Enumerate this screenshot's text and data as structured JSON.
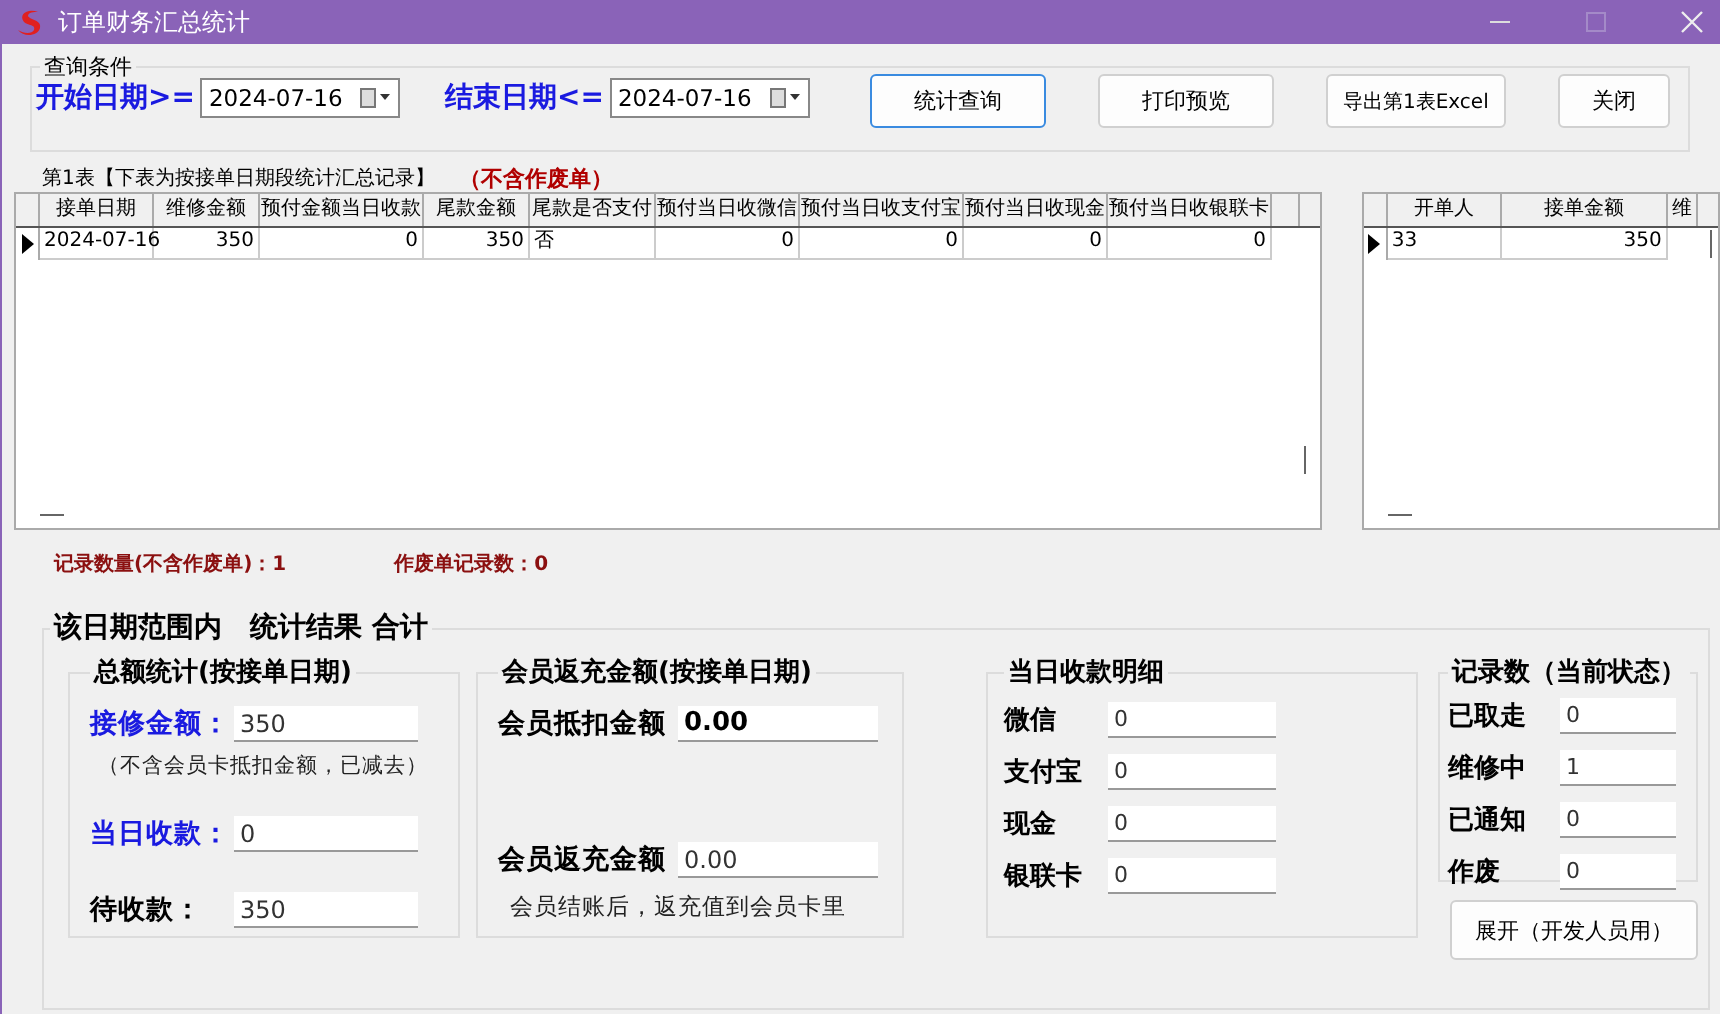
{
  "window": {
    "title": "订单财务汇总统计"
  },
  "query": {
    "legend": "查询条件",
    "start_label": "开始日期>=",
    "start_date": "2024-07-16",
    "end_label": "结束日期<=",
    "end_date": "2024-07-16",
    "buttons": [
      {
        "label": "统计查询",
        "focused": true
      },
      {
        "label": "打印预览",
        "focused": false
      },
      {
        "label": "导出第1表Excel",
        "focused": false
      },
      {
        "label": "关闭",
        "focused": false
      }
    ]
  },
  "table1": {
    "caption": "第1表【下表为按接单日期段统计汇总记录】",
    "note": "（不含作废单）",
    "columns": [
      "接单日期",
      "维修金额",
      "预付金额当日收款",
      "尾款金额",
      "尾款是否支付",
      "预付当日收微信",
      "预付当日收支付宝",
      "预付当日收现金",
      "预付当日收银联卡"
    ],
    "rows": [
      {
        "current": true,
        "cells": [
          "2024-07-16",
          "350",
          "0",
          "350",
          "否",
          "0",
          "0",
          "0",
          "0"
        ]
      }
    ]
  },
  "table2": {
    "columns": [
      "开单人",
      "接单金额",
      "维"
    ],
    "rows": [
      {
        "current": true,
        "cells": [
          "33",
          "350"
        ]
      }
    ]
  },
  "counts": [
    "记录数量(不含作废单)：1",
    "作废单记录数：0"
  ],
  "summary": {
    "legend": "该日期范围内　统计结果 合计",
    "totals": {
      "legend": "总额统计(按接单日期)",
      "fields": [
        {
          "label": "接修金额：",
          "value": "350",
          "emphasized": true,
          "note": "（不含会员卡抵扣金额，已减去）"
        },
        {
          "label": "当日收款：",
          "value": "0",
          "emphasized": true
        },
        {
          "label": "待收款：",
          "value": "350",
          "emphasized": false
        }
      ]
    },
    "member": {
      "legend": "会员返充金额(按接单日期)",
      "fields": [
        {
          "label": "会员抵扣金额",
          "value": "0.00",
          "bold": true
        },
        {
          "label": "会员返充金额",
          "value": "0.00",
          "bold": false,
          "note": "会员结账后，返充值到会员卡里"
        }
      ]
    },
    "daily": {
      "legend": "当日收款明细",
      "fields": [
        {
          "label": "微信",
          "value": "0"
        },
        {
          "label": "支付宝",
          "value": "0"
        },
        {
          "label": "现金",
          "value": "0"
        },
        {
          "label": "银联卡",
          "value": "0"
        }
      ]
    },
    "status": {
      "legend": "记录数（当前状态）",
      "fields": [
        {
          "label": "已取走",
          "value": "0"
        },
        {
          "label": "维修中",
          "value": "1"
        },
        {
          "label": "已通知",
          "value": "0"
        },
        {
          "label": "作废",
          "value": "0"
        }
      ]
    },
    "dev_button": "展开（开发人员用）"
  }
}
